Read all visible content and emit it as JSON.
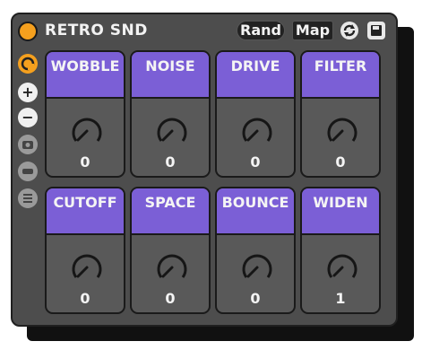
{
  "header": {
    "title": "RETRO SND",
    "rand_label": "Rand",
    "map_label": "Map"
  },
  "icons": {
    "power": "power-icon",
    "sync": "sync-icon",
    "save": "save-icon",
    "sidebar": [
      "orange-circle-icon",
      "plus-icon",
      "minus-icon",
      "camera-icon",
      "bar-icon",
      "list-icon"
    ]
  },
  "colors": {
    "accent": "#f5a01e",
    "cell_header": "#7b5fd6",
    "panel": "#4d4d4d"
  },
  "cells": [
    {
      "label": "WOBBLE",
      "value": "0"
    },
    {
      "label": "NOISE",
      "value": "0"
    },
    {
      "label": "DRIVE",
      "value": "0"
    },
    {
      "label": "FILTER",
      "value": "0"
    },
    {
      "label": "CUTOFF",
      "value": "0"
    },
    {
      "label": "SPACE",
      "value": "0"
    },
    {
      "label": "BOUNCE",
      "value": "0"
    },
    {
      "label": "WIDEN",
      "value": "1"
    }
  ]
}
